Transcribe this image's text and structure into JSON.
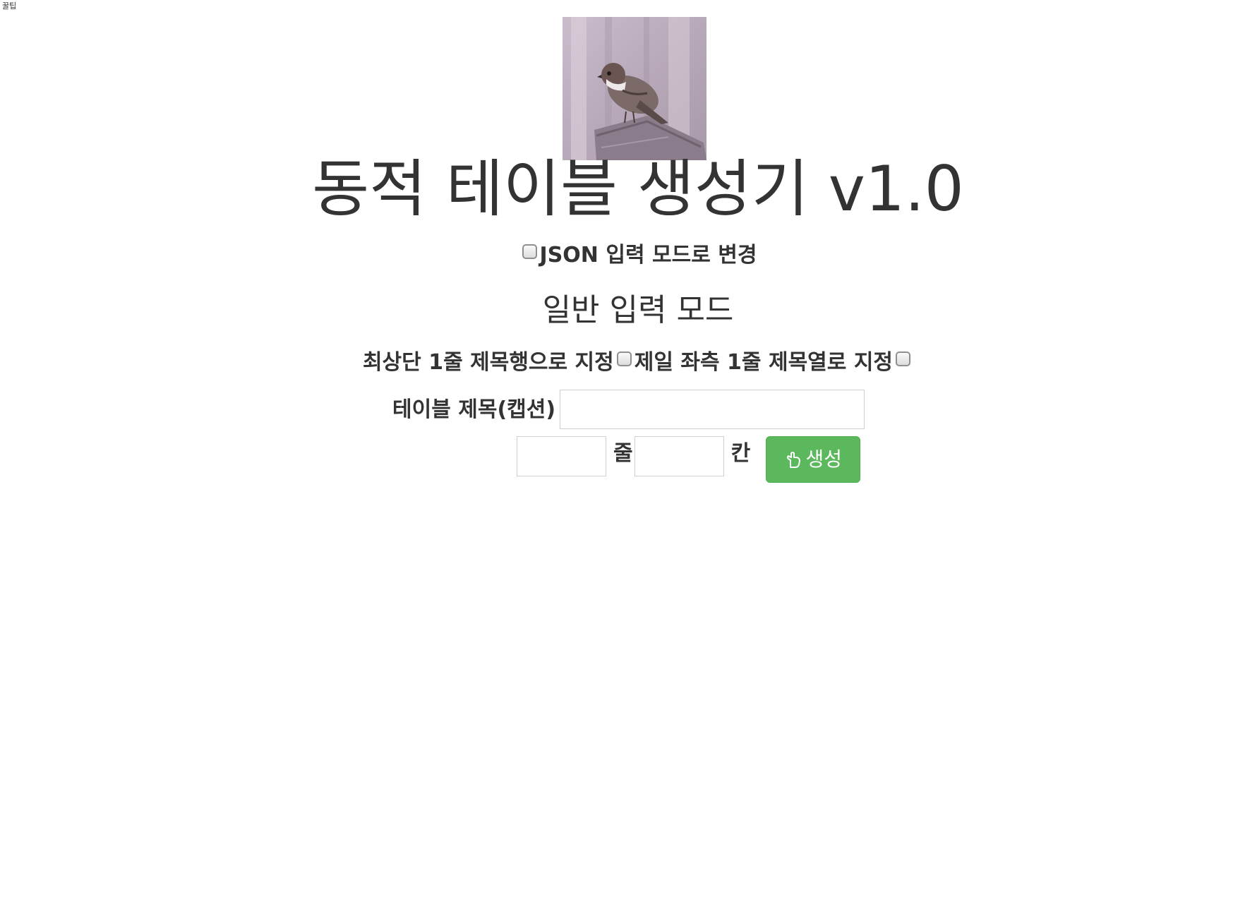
{
  "corner_label": "꿀팁",
  "logo": {
    "description_icon": "sparrow-logo"
  },
  "title": "동적 테이블 생성기 v1.0",
  "json_mode": {
    "label": "JSON 입력 모드로 변경",
    "checked": false
  },
  "mode_heading": "일반 입력 모드",
  "header_options": {
    "top_row_label": "최상단 1줄 제목행으로 지정",
    "top_row_checked": false,
    "left_col_label": "제일 좌측 1줄 제목열로 지정",
    "left_col_checked": false
  },
  "caption": {
    "label": "테이블 제목(캡션)",
    "value": ""
  },
  "size": {
    "rows_value": "",
    "rows_unit": "줄",
    "cols_value": "",
    "cols_unit": "칸"
  },
  "generate_button": {
    "icon": "hand-pointer-icon",
    "label": "생성",
    "color": "#5cb85c"
  }
}
